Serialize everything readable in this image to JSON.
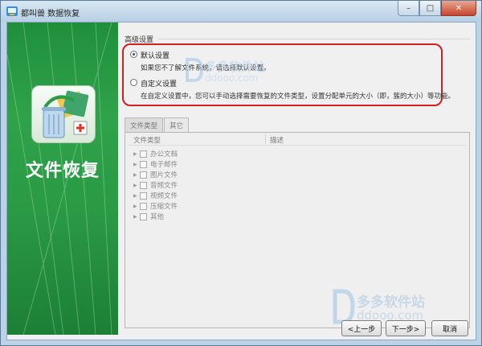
{
  "window": {
    "title": "都叫兽 数据恢复",
    "controls": {
      "minimize": "–",
      "maximize": "□",
      "close": "✕"
    }
  },
  "banner": {
    "title": "文件恢复",
    "icon": "recycle-bin-folder-icon",
    "color": "#2a9a45"
  },
  "advanced": {
    "section_title": "高级设置",
    "default_option": {
      "label": "默认设置",
      "description": "如果您不了解文件系统，请选择默认设置。",
      "selected": true
    },
    "custom_option": {
      "label": "自定义设置",
      "description": "在自定义设置中，您可以手动选择需要恢复的文件类型，设置分配单元的大小（即，簇的大小）等功能。",
      "selected": false
    },
    "highlight_color": "#d21f1f"
  },
  "tabs": [
    {
      "label": "文件类型",
      "active": true
    },
    {
      "label": "其它",
      "active": false
    }
  ],
  "table": {
    "columns": [
      "文件类型",
      "描述"
    ],
    "rows": [
      {
        "label": "办公文档"
      },
      {
        "label": "电子邮件"
      },
      {
        "label": "图片文件"
      },
      {
        "label": "音频文件"
      },
      {
        "label": "视频文件"
      },
      {
        "label": "压缩文件"
      },
      {
        "label": "其他"
      }
    ]
  },
  "watermark": {
    "name": "多多软件站",
    "domain": "ddooo.com"
  },
  "buttons": {
    "back": "<上一步",
    "next": "下一步>",
    "cancel": "取消"
  }
}
